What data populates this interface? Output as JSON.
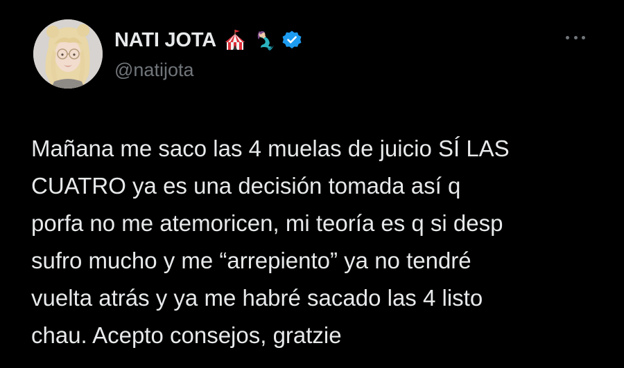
{
  "author": {
    "display_name": "NATI JOTA",
    "handle": "@natijota",
    "name_emojis": [
      "circus-tent-icon",
      "mermaid-icon"
    ],
    "verified": true
  },
  "tweet": {
    "text": "Mañana me saco las 4 muelas de juicio SÍ LAS\nCUATRO ya es una decisión tomada así q\nporfa no me atemoricen, mi teoría es q si desp\nsufro mucho y me “arrepiento” ya no tendré\nvuelta atrás y ya me habré sacado las 4 listo\nchau. Acepto consejos, gratzie"
  },
  "colors": {
    "background": "#000000",
    "text_primary": "#e7e9ea",
    "text_secondary": "#71767b",
    "verified_blue": "#1d9bf0"
  },
  "icons": {
    "more": "more-options-icon"
  }
}
